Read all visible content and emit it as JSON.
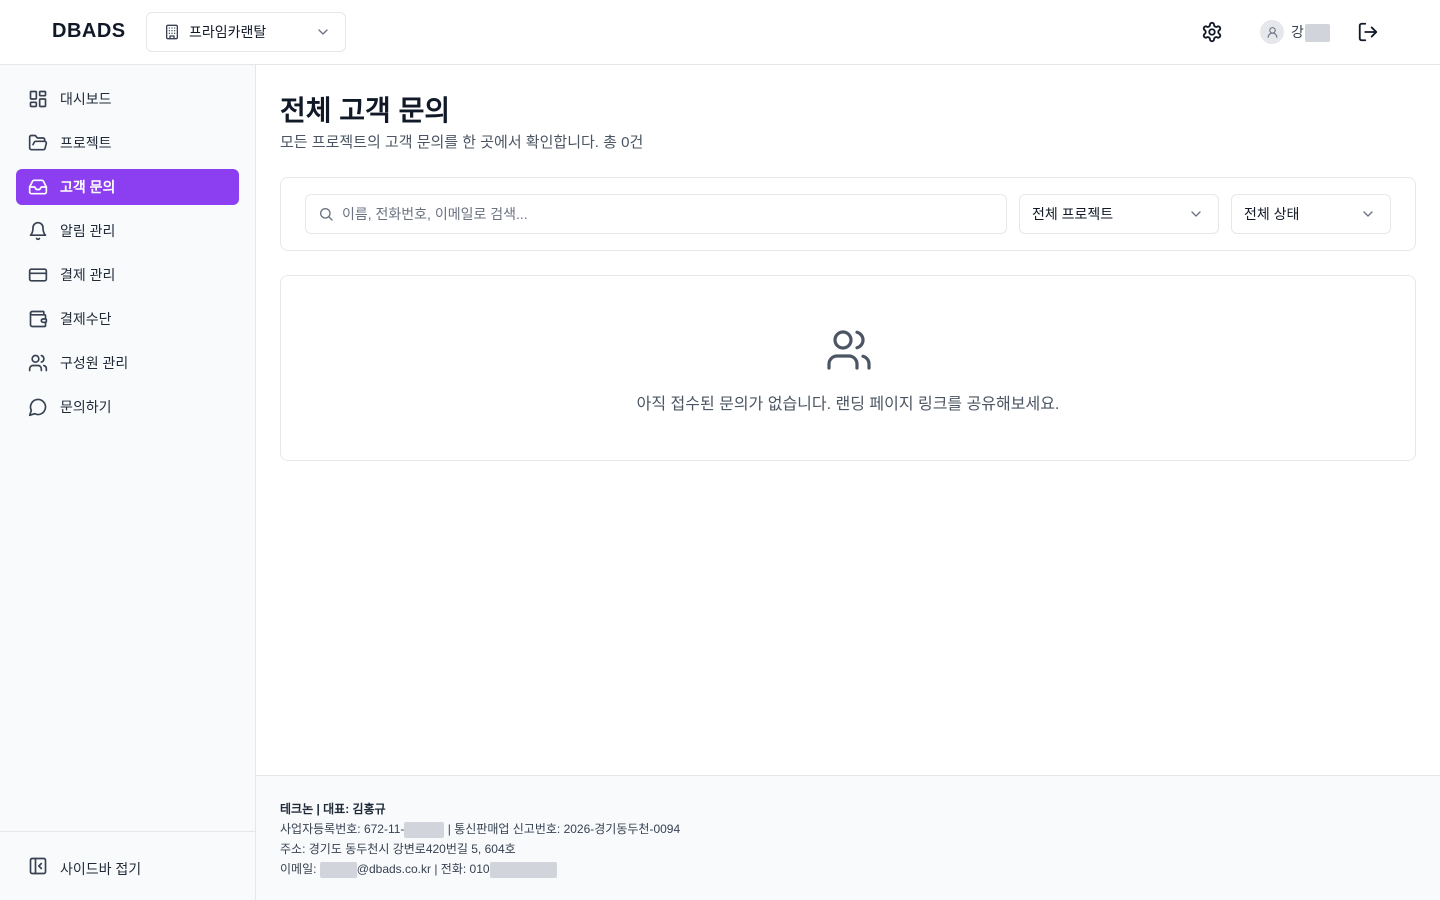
{
  "header": {
    "logo": "DBADS",
    "org_selector": {
      "label": "프라임카랜탈",
      "icon": "building-icon"
    },
    "user": {
      "name_visible": "강"
    }
  },
  "sidebar": {
    "items": [
      {
        "label": "대시보드",
        "icon": "dashboard-grid-icon",
        "active": false
      },
      {
        "label": "프로젝트",
        "icon": "folder-open-icon",
        "active": false
      },
      {
        "label": "고객 문의",
        "icon": "inbox-icon",
        "active": true
      },
      {
        "label": "알림 관리",
        "icon": "bell-icon",
        "active": false
      },
      {
        "label": "결제 관리",
        "icon": "credit-card-icon",
        "active": false
      },
      {
        "label": "결제수단",
        "icon": "wallet-icon",
        "active": false
      },
      {
        "label": "구성원 관리",
        "icon": "users-icon",
        "active": false
      },
      {
        "label": "문의하기",
        "icon": "message-circle-icon",
        "active": false
      }
    ],
    "collapse_label": "사이드바 접기"
  },
  "main": {
    "title": "전체 고객 문의",
    "subtitle": "모든 프로젝트의 고객 문의를 한 곳에서 확인합니다. 총 0건",
    "search": {
      "placeholder": "이름, 전화번호, 이메일로 검색...",
      "value": ""
    },
    "project_filter": {
      "selected": "전체 프로젝트"
    },
    "status_filter": {
      "selected": "전체 상태"
    },
    "empty_state": {
      "message": "아직 접수된 문의가 없습니다. 랜딩 페이지 링크를 공유해보세요.",
      "icon": "users-icon"
    }
  },
  "footer": {
    "company_line": "테크논 | 대표: 김홍규",
    "biz_prefix": "사업자등록번호: 672-11-",
    "biz_suffix": " | 통신판매업 신고번호: 2026-경기동두천-0094",
    "address": "주소: 경기도 동두천시 강변로420번길 5, 604호",
    "email_prefix": "이메일: ",
    "email_suffix": "@dbads.co.kr | 전화: 010"
  },
  "colors": {
    "accent": "#8b3ff0",
    "border": "#e5e7eb",
    "sidebar_bg": "#f8fafc",
    "icon": "#374151"
  }
}
